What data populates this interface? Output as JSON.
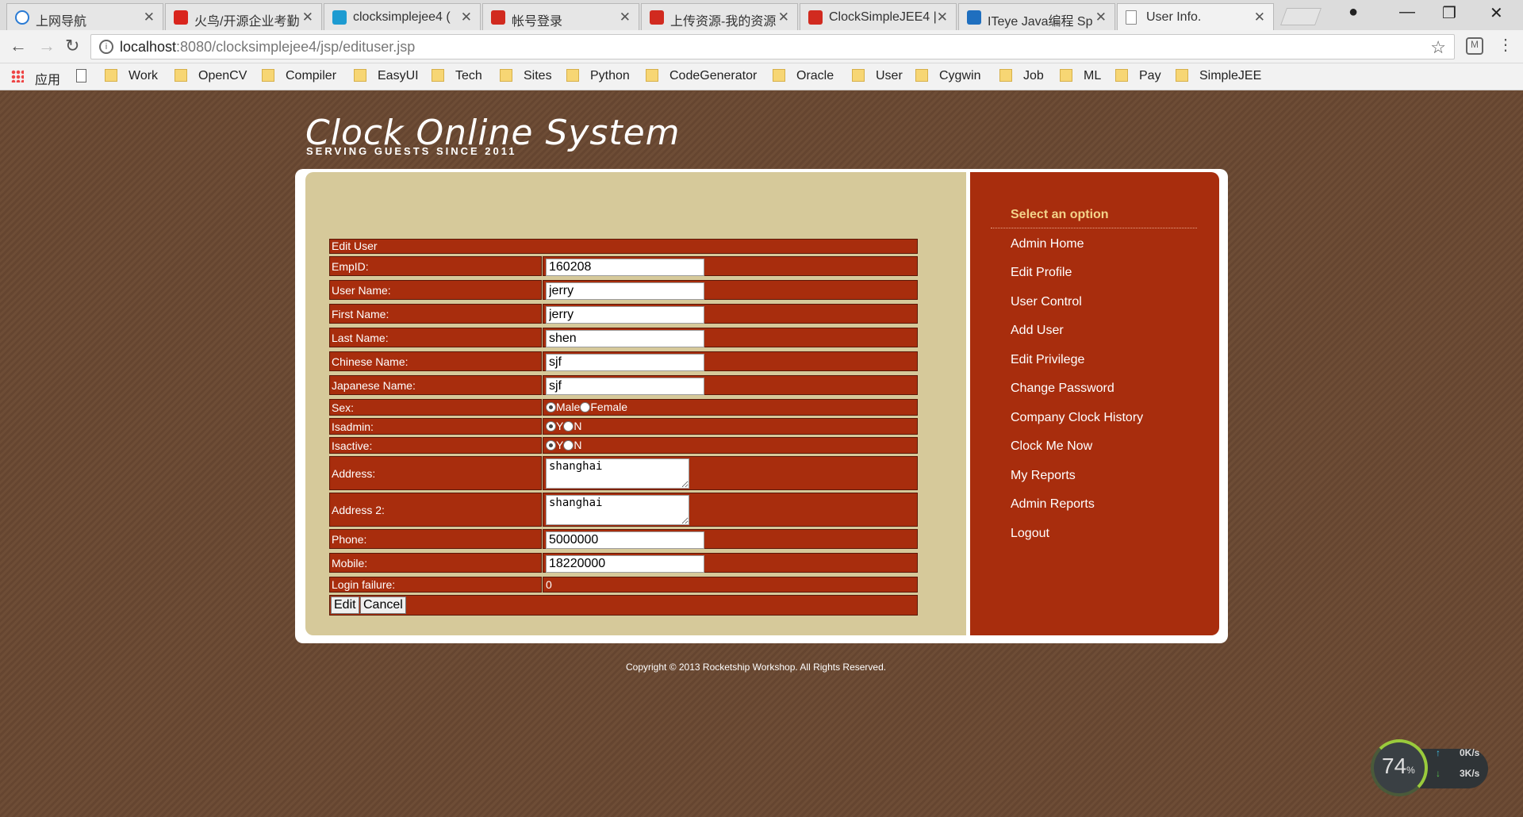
{
  "browser": {
    "tabs": [
      {
        "title": "上网导航",
        "icon": "ie-icon"
      },
      {
        "title": "火鸟/开源企业考勤",
        "icon": "g-icon"
      },
      {
        "title": "clocksimplejee4 (",
        "icon": "bing-icon"
      },
      {
        "title": "帐号登录",
        "icon": "c-icon"
      },
      {
        "title": "上传资源-我的资源",
        "icon": "c-icon"
      },
      {
        "title": "ClockSimpleJEE4 |",
        "icon": "c-icon"
      },
      {
        "title": "ITeye Java编程 Sp",
        "icon": "iteye-icon"
      },
      {
        "title": "User Info.",
        "icon": "document-icon"
      }
    ],
    "url_host": "localhost",
    "url_rest": ":8080/clocksimplejee4/jsp/edituser.jsp",
    "bookmarks": [
      "应用",
      "Work",
      "OpenCV",
      "Compiler",
      "EasyUI",
      "Tech",
      "Sites",
      "Python",
      "CodeGenerator",
      "Oracle",
      "User",
      "Cygwin",
      "Job",
      "ML",
      "Pay",
      "SimpleJEE"
    ]
  },
  "site": {
    "title": "Clock Online System",
    "tagline": "SERVING GUESTS SINCE 2011",
    "footer": "Copyright © 2013 Rocketship Workshop. All Rights Reserved."
  },
  "menu": {
    "heading": "Select an option",
    "items": [
      "Admin Home",
      "Edit Profile",
      "User Control",
      "Add User",
      "Edit Privilege",
      "Change Password",
      "Company Clock History",
      "Clock Me Now",
      "My Reports",
      "Admin Reports",
      "Logout"
    ]
  },
  "form": {
    "title": "Edit User",
    "empid_label": "EmpID:",
    "empid": "160208",
    "username_label": "User Name:",
    "username": "jerry",
    "firstname_label": "First Name:",
    "firstname": "jerry",
    "lastname_label": "Last Name:",
    "lastname": "shen",
    "chinese_label": "Chinese Name:",
    "chinese": "sjf",
    "japanese_label": "Japanese Name:",
    "japanese": "sjf",
    "sex_label": "Sex:",
    "sex_male": "Male",
    "sex_female": "Female",
    "isadmin_label": "Isadmin:",
    "yes": "Y",
    "no": "N",
    "isactive_label": "Isactive:",
    "address_label": "Address:",
    "address": "shanghai",
    "address2_label": "Address 2:",
    "address2": "shanghai",
    "phone_label": "Phone:",
    "phone": "5000000",
    "mobile_label": "Mobile:",
    "mobile": "18220000",
    "loginfail_label": "Login failure:",
    "loginfail": "0",
    "edit_button": "Edit",
    "cancel_button": "Cancel"
  },
  "widget": {
    "percent": "74",
    "percent_unit": "%",
    "up": "0K/s",
    "down": "3K/s"
  }
}
